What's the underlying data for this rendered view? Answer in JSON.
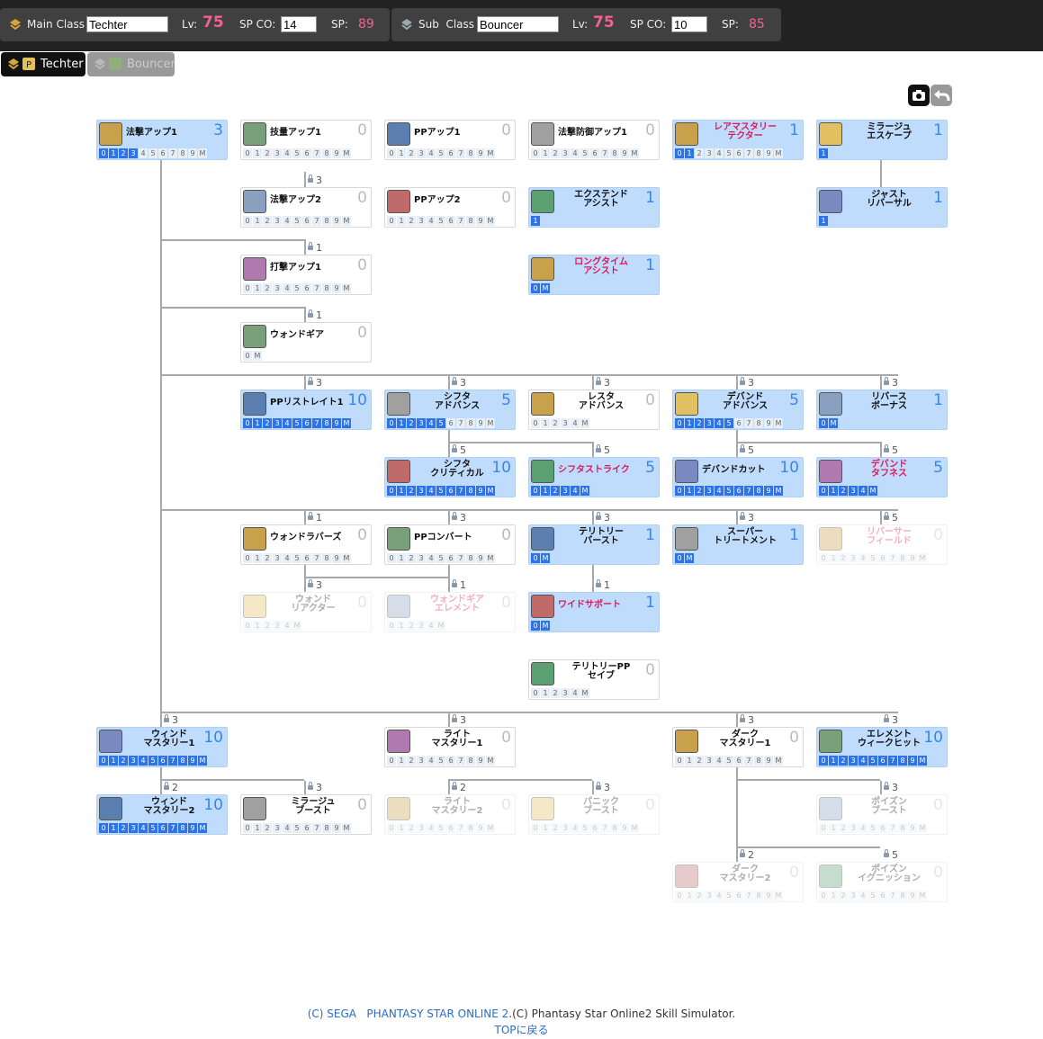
{
  "header": {
    "main": {
      "label": "Main Class",
      "value": "Techter",
      "lv_label": "Lv:",
      "lv": "75",
      "spco_label": "SP CO:",
      "spco": "14",
      "sp_label": "SP:",
      "sp": "89"
    },
    "sub": {
      "label": "Sub  Class",
      "value": "Bouncer",
      "lv_label": "Lv:",
      "lv": "75",
      "spco_label": "SP CO:",
      "spco": "10",
      "sp_label": "SP:",
      "sp": "85"
    }
  },
  "tabs": [
    "Techter",
    "Bouncer"
  ],
  "skills": [
    {
      "id": "s1",
      "name": "法撃アップ1",
      "level": "3",
      "bar": "0123456789M",
      "filled": 4,
      "on": true,
      "single": true
    },
    {
      "id": "s2",
      "name": "技量アップ1",
      "level": "0",
      "bar": "0123456789M",
      "filled": 0,
      "single": true
    },
    {
      "id": "s3",
      "name": "PPアップ1",
      "level": "0",
      "bar": "0123456789M",
      "filled": 0,
      "single": true
    },
    {
      "id": "s4",
      "name": "法撃防御アップ1",
      "level": "0",
      "bar": "0123456789M",
      "filled": 0,
      "single": true
    },
    {
      "id": "s5",
      "name": "レアマスタリー\nテクター",
      "level": "1",
      "bar": "0123456789M",
      "filled": 2,
      "on": true,
      "pink": true
    },
    {
      "id": "s6",
      "name": "ミラージュ\nエスケープ",
      "level": "1",
      "bar": "1",
      "filled": 1,
      "on": true
    },
    {
      "id": "s7",
      "name": "法撃アップ2",
      "level": "0",
      "bar": "0123456789M",
      "filled": 0,
      "single": true
    },
    {
      "id": "s8",
      "name": "PPアップ2",
      "level": "0",
      "bar": "0123456789M",
      "filled": 0,
      "single": true
    },
    {
      "id": "s9",
      "name": "エクステンド\nアシスト",
      "level": "1",
      "bar": "1",
      "filled": 1,
      "on": true
    },
    {
      "id": "s10",
      "name": "ジャスト\nリバーサル",
      "level": "1",
      "bar": "1",
      "filled": 1,
      "on": true
    },
    {
      "id": "s11",
      "name": "打撃アップ1",
      "level": "0",
      "bar": "0123456789M",
      "filled": 0,
      "single": true
    },
    {
      "id": "s12",
      "name": "ロングタイム\nアシスト",
      "level": "1",
      "bar": "0M",
      "filled": 2,
      "on": true,
      "pink": true
    },
    {
      "id": "s13",
      "name": "ウォンドギア",
      "level": "0",
      "bar": "0M",
      "filled": 0,
      "single": true
    },
    {
      "id": "s14",
      "name": "PPリストレイト1",
      "level": "10",
      "bar": "0123456789M",
      "filled": 11,
      "on": true,
      "single": true
    },
    {
      "id": "s15",
      "name": "シフタ\nアドバンス",
      "level": "5",
      "bar": "0123456789M",
      "filled": 6,
      "on": true
    },
    {
      "id": "s16",
      "name": "レスタ\nアドバンス",
      "level": "0",
      "bar": "01234M",
      "filled": 0
    },
    {
      "id": "s17",
      "name": "デバンド\nアドバンス",
      "level": "5",
      "bar": "0123456789M",
      "filled": 6,
      "on": true
    },
    {
      "id": "s18",
      "name": "リバース\nボーナス",
      "level": "1",
      "bar": "0M",
      "filled": 2,
      "on": true
    },
    {
      "id": "s19",
      "name": "シフタ\nクリティカル",
      "level": "10",
      "bar": "0123456789M",
      "filled": 11,
      "on": true
    },
    {
      "id": "s20",
      "name": "シフタストライク",
      "level": "5",
      "bar": "01234M",
      "filled": 6,
      "on": true,
      "pink": true,
      "single": true
    },
    {
      "id": "s21",
      "name": "デバンドカット",
      "level": "10",
      "bar": "0123456789M",
      "filled": 11,
      "on": true,
      "single": true
    },
    {
      "id": "s22",
      "name": "デバンド\nタフネス",
      "level": "5",
      "bar": "01234M",
      "filled": 6,
      "on": true,
      "pink": true
    },
    {
      "id": "s23",
      "name": "ウォンドラバーズ",
      "level": "0",
      "bar": "0123456789M",
      "filled": 0,
      "single": true
    },
    {
      "id": "s24",
      "name": "PPコンバート",
      "level": "0",
      "bar": "0123456789M",
      "filled": 0,
      "single": true
    },
    {
      "id": "s25",
      "name": "テリトリー\nバースト",
      "level": "1",
      "bar": "0M",
      "filled": 2,
      "on": true
    },
    {
      "id": "s26",
      "name": "スーパー\nトリートメント",
      "level": "1",
      "bar": "0M",
      "filled": 2,
      "on": true
    },
    {
      "id": "s27",
      "name": "リバーサー\nフィールド",
      "level": "0",
      "bar": "0123456789M",
      "filled": 0,
      "dim": true,
      "pink": true
    },
    {
      "id": "s28",
      "name": "ウォンド\nリアクター",
      "level": "0",
      "bar": "01234M",
      "filled": 0,
      "dim": true
    },
    {
      "id": "s29",
      "name": "ウォンドギア\nエレメント",
      "level": "0",
      "bar": "01234M",
      "filled": 0,
      "dim": true,
      "pink": true
    },
    {
      "id": "s30",
      "name": "ワイドサポート",
      "level": "1",
      "bar": "0M",
      "filled": 2,
      "on": true,
      "pink": true,
      "single": true
    },
    {
      "id": "s31",
      "name": "テリトリーPP\nセイブ",
      "level": "0",
      "bar": "01234M",
      "filled": 0
    },
    {
      "id": "s32",
      "name": "ウィンド\nマスタリー1",
      "level": "10",
      "bar": "0123456789M",
      "filled": 11,
      "on": true
    },
    {
      "id": "s33",
      "name": "ライト\nマスタリー1",
      "level": "0",
      "bar": "0123456789M",
      "filled": 0
    },
    {
      "id": "s34",
      "name": "ダーク\nマスタリー1",
      "level": "0",
      "bar": "0123456789M",
      "filled": 0
    },
    {
      "id": "s35",
      "name": "エレメント\nウィークヒット",
      "level": "10",
      "bar": "0123456789M",
      "filled": 11,
      "on": true
    },
    {
      "id": "s36",
      "name": "ウィンド\nマスタリー2",
      "level": "10",
      "bar": "0123456789M",
      "filled": 11,
      "on": true
    },
    {
      "id": "s37",
      "name": "ミラージュ\nブースト",
      "level": "0",
      "bar": "0123456789M",
      "filled": 0
    },
    {
      "id": "s38",
      "name": "ライト\nマスタリー2",
      "level": "0",
      "bar": "0123456789M",
      "filled": 0,
      "dim": true
    },
    {
      "id": "s39",
      "name": "パニック\nブースト",
      "level": "0",
      "bar": "0123456789M",
      "filled": 0,
      "dim": true
    },
    {
      "id": "s40",
      "name": "ポイズン\nブースト",
      "level": "0",
      "bar": "0123456789M",
      "filled": 0,
      "dim": true
    },
    {
      "id": "s41",
      "name": "ダーク\nマスタリー2",
      "level": "0",
      "bar": "0123456789M",
      "filled": 0,
      "dim": true
    },
    {
      "id": "s42",
      "name": "ポイズン\nイグニッション",
      "level": "0",
      "bar": "0123456789M",
      "filled": 0,
      "dim": true
    }
  ],
  "requirements": [
    "3",
    "1",
    "1",
    "3",
    "3",
    "3",
    "3",
    "3",
    "5",
    "5",
    "5",
    "5",
    "1",
    "3",
    "3",
    "3",
    "5",
    "3",
    "1",
    "1",
    "3",
    "3",
    "3",
    "3",
    "2",
    "3",
    "2",
    "3",
    "3",
    "2",
    "5"
  ],
  "colors": {
    "accent_pink": "#f06292",
    "filled_blue": "#2f73e8",
    "active_bg": "#bfdcfd"
  },
  "footer": {
    "line1_a": "(C) SEGA   PHANTASY STAR ONLINE 2",
    "line1_b": ".(C) Phantasy Star Online2 Skill Simulator.",
    "top_link": "TOPに戻る"
  }
}
